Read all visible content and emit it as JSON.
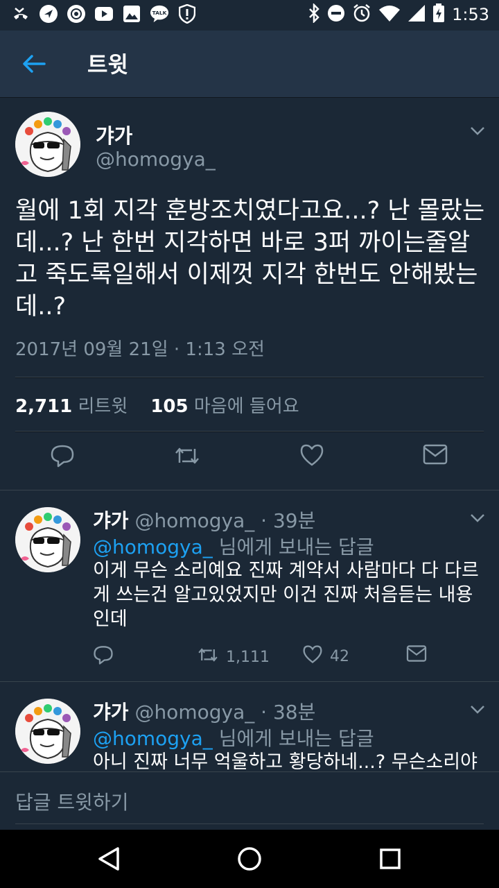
{
  "status_bar": {
    "time": "1:53",
    "talk_label": "TALK",
    "left_icons": [
      "missed-call-icon",
      "navigation-icon",
      "sync-icon",
      "youtube-icon",
      "image-icon",
      "kakaotalk-icon",
      "alert-icon"
    ],
    "right_icons": [
      "bluetooth-icon",
      "do-not-disturb-icon",
      "alarm-icon",
      "wifi-icon",
      "signal-icon",
      "battery-icon"
    ]
  },
  "app_bar": {
    "title": "트윗"
  },
  "main_tweet": {
    "name": "갸가",
    "handle": "@homogya_",
    "text": "월에 1회 지각 훈방조치였다고요...? 난 몰랐는데...? 난 한번 지각하면 바로 3퍼 까이는줄알고 죽도록일해서 이제껏 지각 한번도 안해봤는데..?",
    "timestamp": "2017년 09월 21일 · 1:13 오전",
    "retweet_count": "2,711",
    "retweet_label": "리트윗",
    "like_count": "105",
    "like_label": "마음에 들어요"
  },
  "replies": [
    {
      "name": "갸가",
      "handle": "@homogya_",
      "time": "· 39분",
      "mention": "@homogya_",
      "reply_to_suffix": " 님에게 보내는 답글",
      "text": "이게 무슨 소리예요 진짜 계약서 사람마다 다 다르게 쓰는건 알고있었지만 이건 진짜 처음듣는 내용인데",
      "retweets": "1,111",
      "likes": "42"
    },
    {
      "name": "갸가",
      "handle": "@homogya_",
      "time": "· 38분",
      "mention": "@homogya_",
      "reply_to_suffix": " 님에게 보내는 답글",
      "text": "아니 진짜 너무 억울하고 황당하네...? 무슨소리야"
    }
  ],
  "compose": {
    "placeholder": "답글 트윗하기"
  },
  "colors": {
    "background": "#1b2836",
    "appbar": "#243447",
    "accent": "#1da1f2",
    "muted": "#8899a6"
  }
}
